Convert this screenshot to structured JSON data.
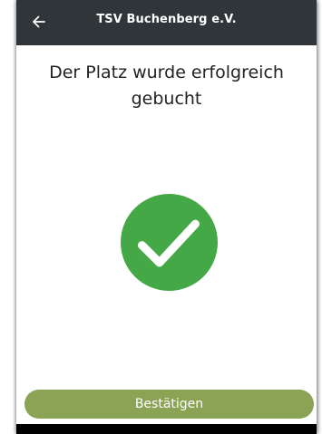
{
  "appbar": {
    "title": "TSV Buchenberg e.V.",
    "back_icon": "arrow-left-icon",
    "background": "#30353a"
  },
  "main": {
    "message": "Der Platz wurde erfolgreich gebucht",
    "status_icon": "check-circle-icon",
    "success_color": "#44a846"
  },
  "footer": {
    "confirm_label": "Bestätigen",
    "button_color": "#8ba354"
  }
}
